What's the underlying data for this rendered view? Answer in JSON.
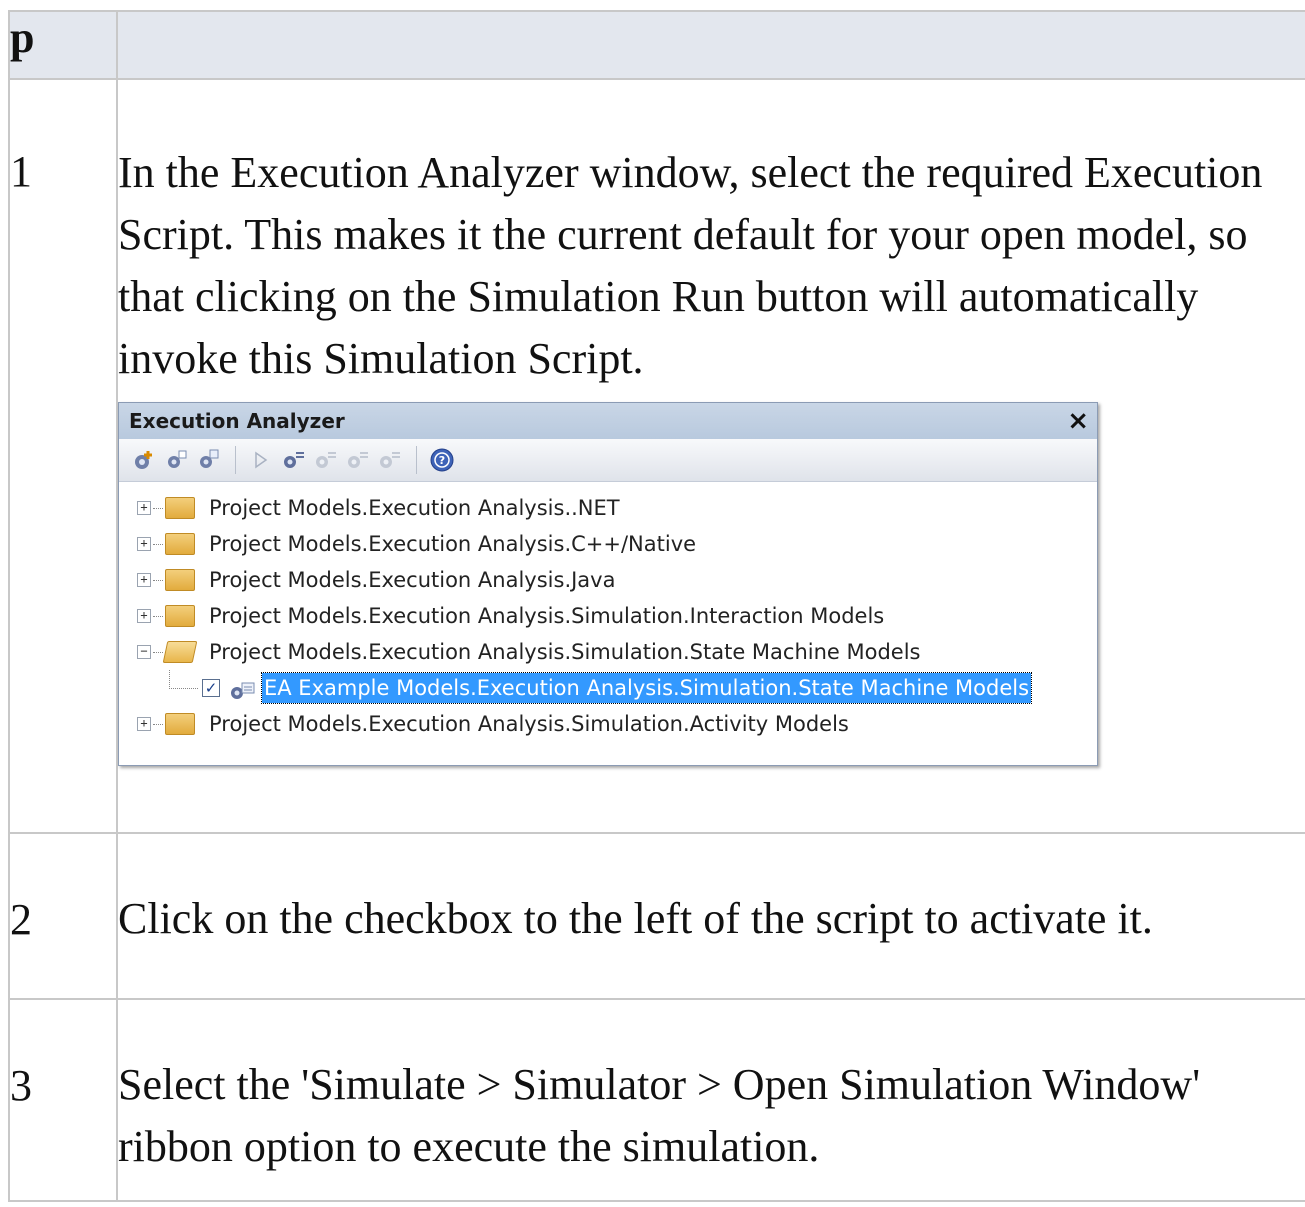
{
  "table": {
    "header": {
      "col1": "p",
      "col2": ""
    },
    "steps": [
      {
        "num": "1",
        "text": "In the Execution Analyzer window, select the required Execution Script. This makes it the current default for your open model, so that clicking on the Simulation Run button will automatically invoke this Simulation Script."
      },
      {
        "num": "2",
        "text": "Click on the checkbox to the left of the script to activate it."
      },
      {
        "num": "3",
        "text": "Select the 'Simulate > Simulator > Open Simulation Window' ribbon option to execute the simulation."
      }
    ]
  },
  "execution_analyzer": {
    "title": "Execution Analyzer",
    "close_glyph": "×",
    "tree": [
      {
        "label": "Project Models.Execution Analysis..NET",
        "expander": "+"
      },
      {
        "label": "Project Models.Execution Analysis.C++/Native",
        "expander": "+"
      },
      {
        "label": "Project Models.Execution Analysis.Java",
        "expander": "+"
      },
      {
        "label": "Project Models.Execution Analysis.Simulation.Interaction Models",
        "expander": "+"
      },
      {
        "label": "Project Models.Execution Analysis.Simulation.State Machine Models",
        "expander": "−"
      },
      {
        "label": "EA Example Models.Execution Analysis.Simulation.State Machine Models",
        "checked": "✓"
      },
      {
        "label": "Project Models.Execution Analysis.Simulation.Activity Models",
        "expander": "+"
      }
    ]
  },
  "colors": {
    "header_bg": "#e3e7ee",
    "selection": "#3399ff",
    "border": "#c8c8c8"
  }
}
